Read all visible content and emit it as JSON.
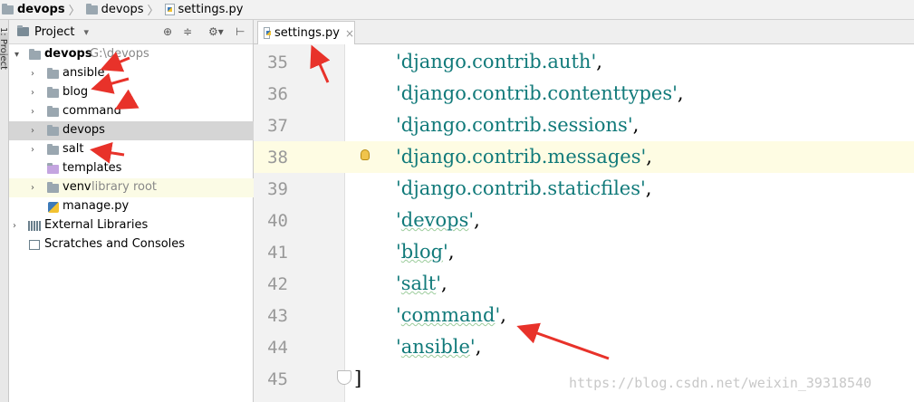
{
  "breadcrumb": {
    "items": [
      {
        "label": "devops",
        "icon": "folder-icon"
      },
      {
        "label": "devops",
        "icon": "folder-icon"
      },
      {
        "label": "settings.py",
        "icon": "python-file-icon"
      }
    ]
  },
  "sidebar": {
    "strip_label": "1: Project"
  },
  "project_panel": {
    "title": "Project",
    "dropdown_glyph": "▾",
    "tools": [
      "target-icon",
      "collapse-icon",
      "gear-icon",
      "hide-icon"
    ],
    "tree": [
      {
        "label": "devops",
        "hint": "G:\\devops",
        "bold": true
      },
      {
        "label": "ansible"
      },
      {
        "label": "blog"
      },
      {
        "label": "command"
      },
      {
        "label": "devops"
      },
      {
        "label": "salt"
      },
      {
        "label": "templates"
      },
      {
        "label": "venv",
        "hint": "library root"
      },
      {
        "label": "manage.py"
      },
      {
        "label": "External Libraries"
      },
      {
        "label": "Scratches and Consoles"
      }
    ]
  },
  "editor": {
    "tab": {
      "label": "settings.py",
      "close": "×"
    },
    "lines": [
      {
        "num": "35",
        "open": "'",
        "text": "django.contrib.auth",
        "close": "'",
        "tail": ","
      },
      {
        "num": "36",
        "open": "'",
        "text": "django.contrib.contenttypes",
        "close": "'",
        "tail": ","
      },
      {
        "num": "37",
        "open": "'",
        "text": "django.contrib.sessions",
        "close": "'",
        "tail": ","
      },
      {
        "num": "38",
        "open": "'",
        "text": "django.contrib.messages",
        "close": "'",
        "tail": ","
      },
      {
        "num": "39",
        "open": "'",
        "text": "django.contrib.staticfiles",
        "close": "'",
        "tail": ","
      },
      {
        "num": "40",
        "open": "'",
        "text": "devops",
        "close": "'",
        "tail": ","
      },
      {
        "num": "41",
        "open": "'",
        "text": "blog",
        "close": "'",
        "tail": ","
      },
      {
        "num": "42",
        "open": "'",
        "text": "salt",
        "close": "'",
        "tail": ","
      },
      {
        "num": "43",
        "open": "'",
        "text": "command",
        "close": "'",
        "tail": ","
      },
      {
        "num": "44",
        "open": "'",
        "text": "ansible",
        "close": "'",
        "tail": ","
      },
      {
        "num": "45",
        "open": "",
        "text": "",
        "close": "",
        "tail": "]"
      }
    ]
  },
  "watermark": "https://blog.csdn.net/weixin_39318540",
  "colors": {
    "string": "#117a7a",
    "annotation": "#e8322a",
    "selected_row": "#d5d5d5",
    "highlight_line": "#fefce3"
  }
}
